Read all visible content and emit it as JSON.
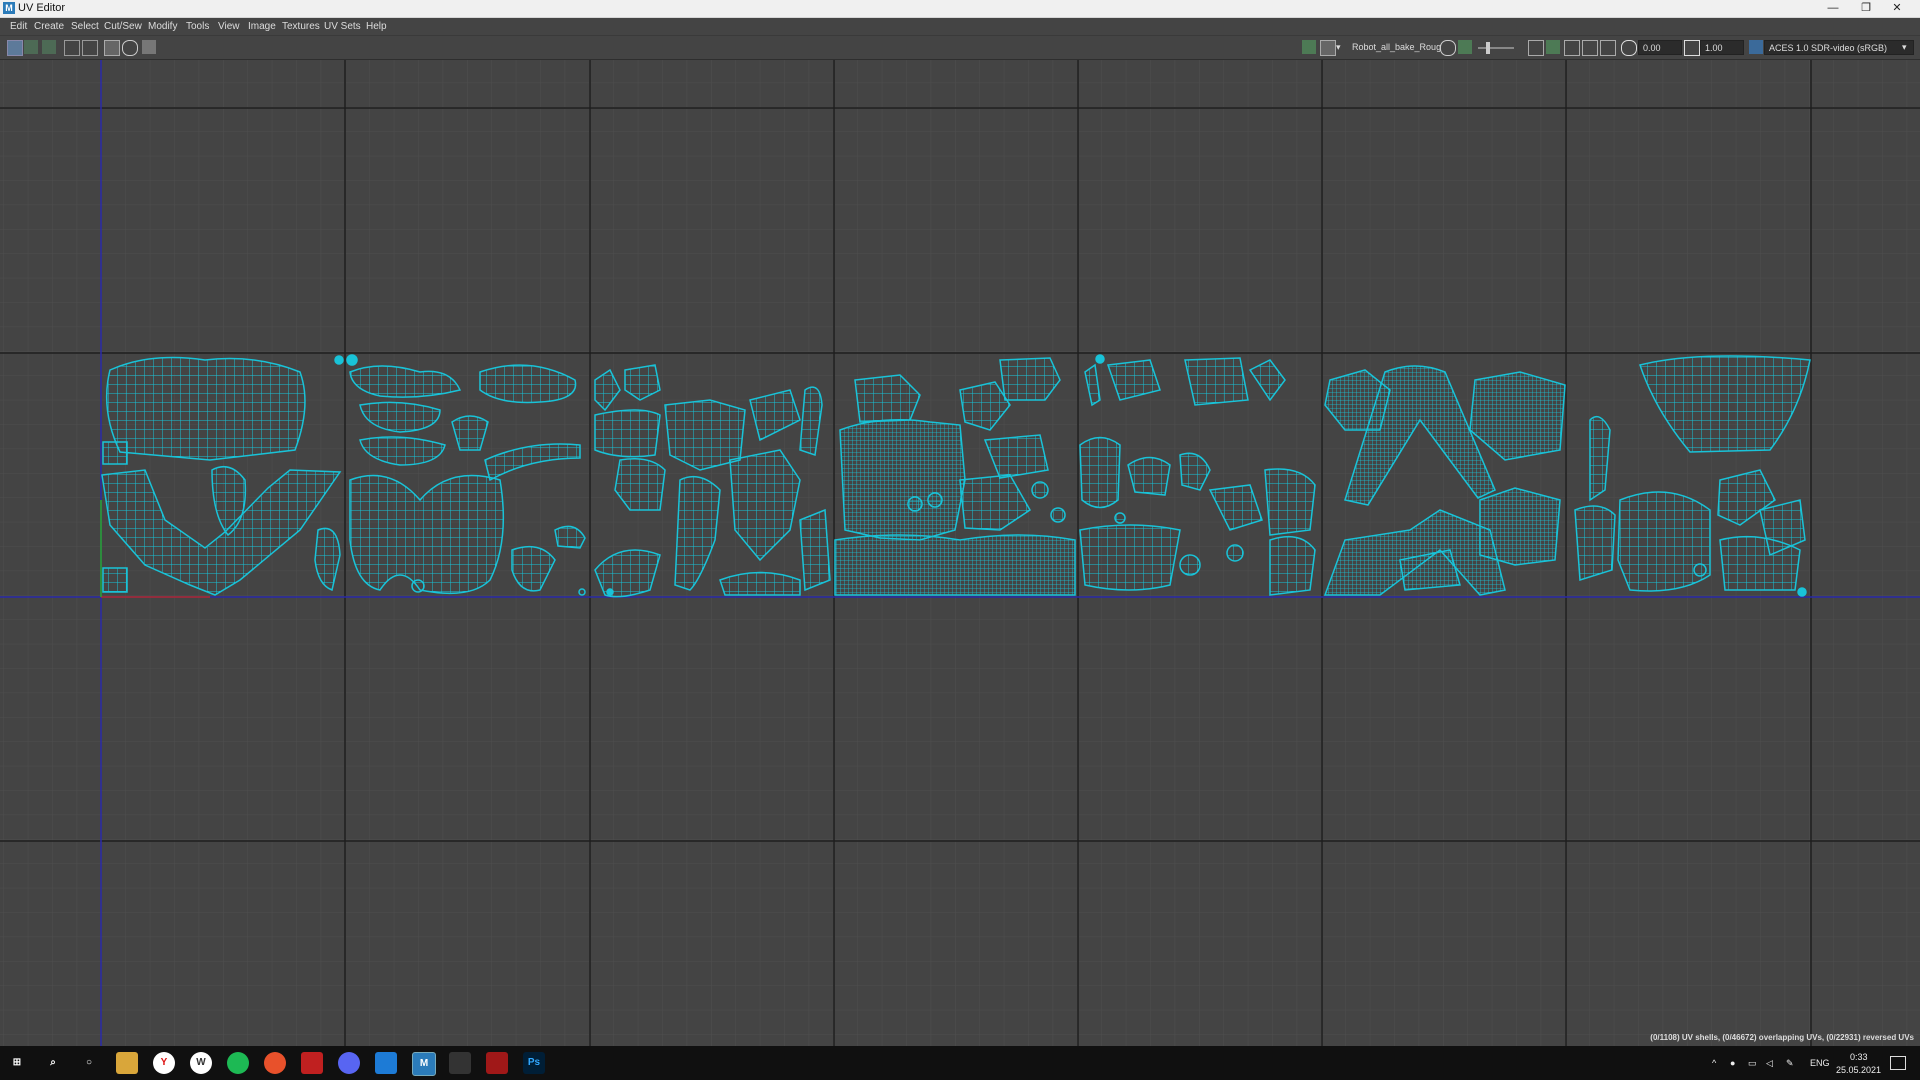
{
  "window": {
    "title": "UV Editor",
    "app_icon_letter": "M"
  },
  "window_controls": {
    "minimize": "—",
    "maximize": "❐",
    "close": "✕"
  },
  "menu": [
    "Edit",
    "Create",
    "Select",
    "Cut/Sew",
    "Modify",
    "Tools",
    "View",
    "Image",
    "Textures",
    "UV Sets",
    "Help"
  ],
  "toolbar": {
    "texture_name": "Robot_all_bake_Roug",
    "exposure": "0.00",
    "gamma": "1.00",
    "view_transform": "ACES 1.0 SDR-video (sRGB)"
  },
  "status": {
    "uv_info": "(0/1108) UV shells, (0/46672) overlapping UVs, (0/22931) reversed UVs"
  },
  "taskbar": {
    "icons": [
      "windows-start",
      "search",
      "cortana",
      "file-explorer",
      "yandex-browser",
      "app-w",
      "spotify",
      "app-orange",
      "app-red",
      "discord",
      "app-blue",
      "maya",
      "app-dark",
      "app-red-2",
      "photoshop"
    ],
    "language": "ENG",
    "time": "0:33",
    "date": "25.05.2021"
  },
  "colors": {
    "uv_wire": "#19c3d8",
    "grid_major": "#1e1e1e",
    "axis_u": "#2a2aa8",
    "axis_v": "#2a2aa8"
  }
}
